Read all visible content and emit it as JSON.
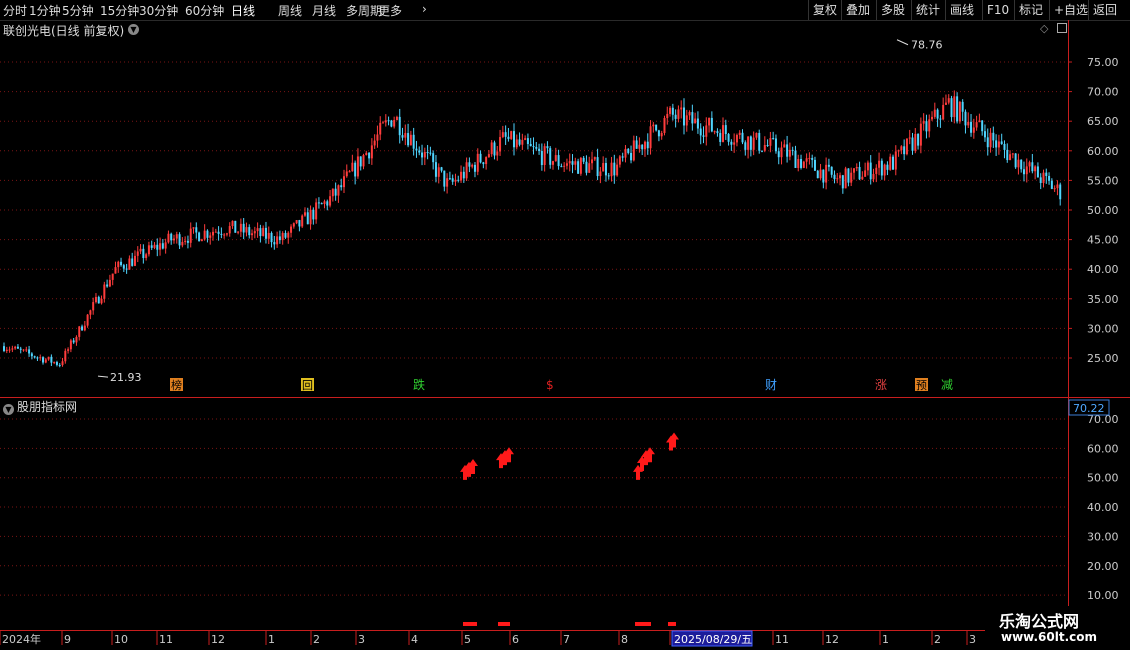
{
  "toolbar": {
    "periods": [
      "分时",
      "1分钟",
      "5分钟",
      "15分钟",
      "30分钟",
      "60分钟",
      "日线",
      "周线",
      "月线",
      "多周期",
      "更多"
    ],
    "active_period": "日线",
    "tools": [
      "复权",
      "叠加",
      "多股",
      "统计",
      "画线",
      "F10",
      "标记",
      "+自选",
      "返回"
    ]
  },
  "main_panel": {
    "title": "联创光电(日线 前复权)",
    "y_ticks": [
      "75.00",
      "70.00",
      "65.00",
      "60.00",
      "55.00",
      "50.00",
      "45.00",
      "40.00",
      "35.00",
      "30.00",
      "25.00"
    ],
    "high_label": "78.76",
    "low_label": "21.93",
    "event_markers": [
      {
        "text": "榜",
        "type": "box",
        "color": "#e08020"
      },
      {
        "text": "回",
        "type": "box",
        "color": "#e0c020"
      },
      {
        "text": "跌",
        "type": "plain",
        "color": "#30d030"
      },
      {
        "text": "$",
        "type": "plain",
        "color": "#e02020"
      },
      {
        "text": "财",
        "type": "plain",
        "color": "#40a0ff"
      },
      {
        "text": "涨",
        "type": "plain",
        "color": "#e04040"
      },
      {
        "text": "预",
        "type": "box",
        "color": "#e08020"
      },
      {
        "text": "减",
        "type": "plain",
        "color": "#30d030"
      }
    ],
    "colors": {
      "up": "#ff3c3c",
      "down": "#4fd5ff",
      "grid": "#7a1515",
      "axis": "#c81e1e"
    }
  },
  "indicator_panel": {
    "title": "股朋指标网",
    "value_label": "70.22",
    "y_ticks": [
      "70.00",
      "60.00",
      "50.00",
      "40.00",
      "30.00",
      "20.00",
      "10.00"
    ],
    "arrow_color": "#ff1a1a"
  },
  "x_axis": {
    "labels": [
      "2024年",
      "9",
      "10",
      "11",
      "12",
      "1",
      "2",
      "3",
      "4",
      "5",
      "6",
      "7",
      "8",
      "2025/08/29/五",
      "11",
      "12",
      "1",
      "2",
      "3"
    ]
  },
  "watermark": {
    "line1": "乐淘公式网",
    "line2": "www.60lt.com"
  },
  "chart_data": {
    "type": "candlestick",
    "title": "联创光电(日线 前复权)",
    "x_range": [
      "2024年8月",
      "2026年3月"
    ],
    "ylim": [
      21,
      80
    ],
    "high": 78.76,
    "low": 21.93,
    "approx_closes": [
      {
        "period": "2024年8月",
        "close": 27
      },
      {
        "period": "2024年9月",
        "close": 24
      },
      {
        "period": "2024年10月",
        "close": 40
      },
      {
        "period": "2024年11月",
        "close": 45
      },
      {
        "period": "2024年12月",
        "close": 47
      },
      {
        "period": "2025年1月",
        "close": 45
      },
      {
        "period": "2025年2月",
        "close": 53
      },
      {
        "period": "2025年3月",
        "close": 66
      },
      {
        "period": "2025年4月",
        "close": 54
      },
      {
        "period": "2025年5月",
        "close": 62
      },
      {
        "period": "2025年6月",
        "close": 58
      },
      {
        "period": "2025年7月",
        "close": 57
      },
      {
        "period": "2025年8月",
        "close": 66
      },
      {
        "period": "2025年9月",
        "close": 63
      },
      {
        "period": "2025年10月",
        "close": 60
      },
      {
        "period": "2025年11月",
        "close": 55
      },
      {
        "period": "2025年12月",
        "close": 58
      },
      {
        "period": "2026年1月",
        "close": 68
      },
      {
        "period": "2026年2月",
        "close": 60
      },
      {
        "period": "2026年3月",
        "close": 53
      }
    ]
  }
}
